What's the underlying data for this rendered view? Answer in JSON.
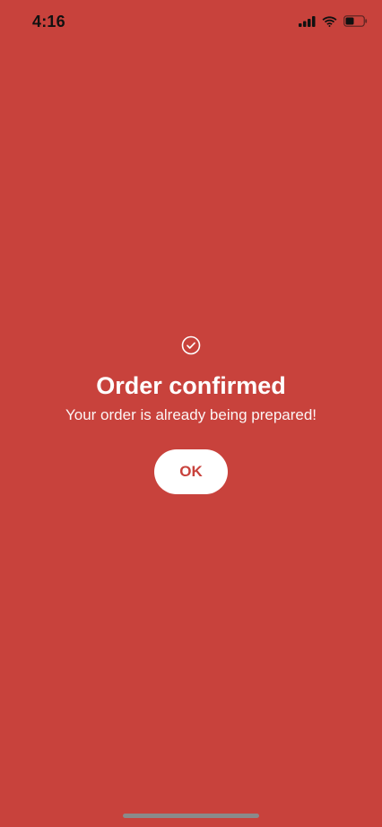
{
  "status_bar": {
    "time": "4:16",
    "icons": [
      "cellular-signal-icon",
      "wifi-icon",
      "battery-icon"
    ]
  },
  "confirmation": {
    "icon": "check-circle-icon",
    "title": "Order confirmed",
    "message": "Your order is already being prepared!",
    "ok_label": "OK"
  },
  "colors": {
    "background": "#C8423C",
    "button_background": "#FFFFFF",
    "button_text": "#C8423C",
    "text": "#FFFFFF"
  }
}
